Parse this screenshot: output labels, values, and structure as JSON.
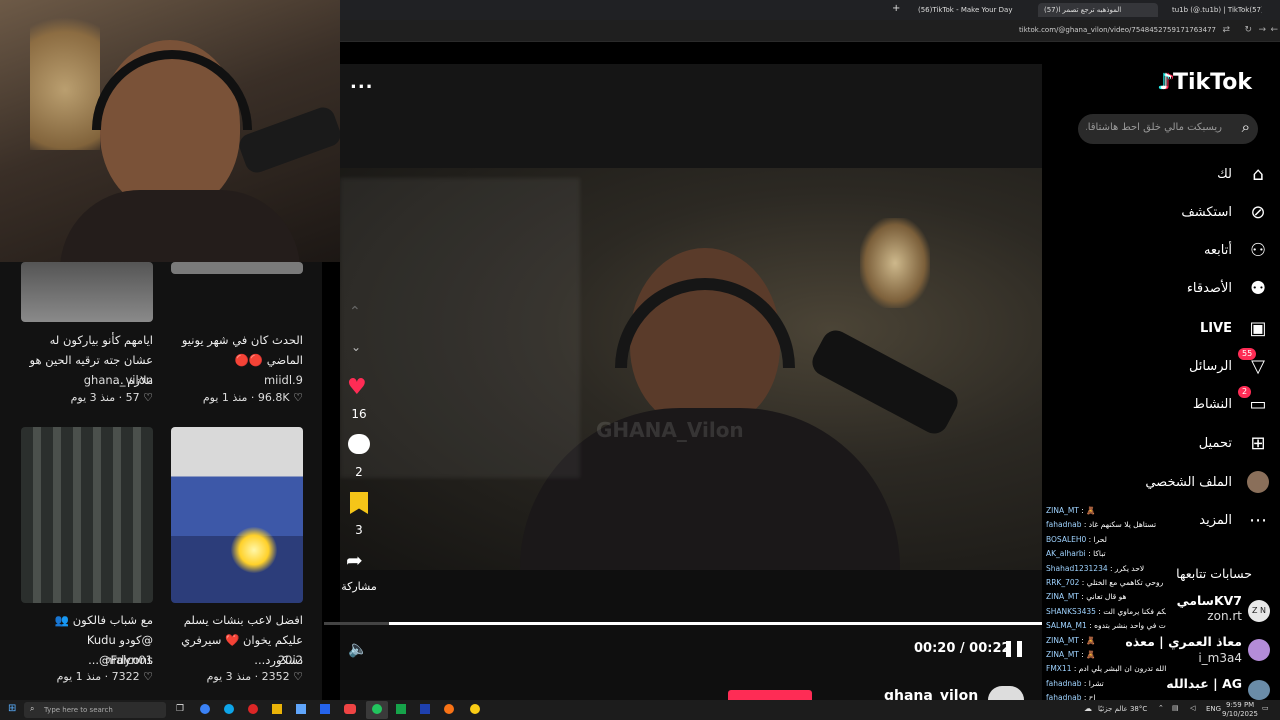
{
  "browser": {
    "tabs": [
      {
        "label": "(56)TikTok - Make Your Day"
      },
      {
        "label": "(57)الموذهبه ترجع تصمر ا"
      },
      {
        "label": "tu1b (@.tu1b) | TikTok(57)"
      }
    ],
    "url": "tiktok.com/@ghana_vilon/video/7548452759171763477"
  },
  "sidebar": {
    "logo": "TikTok",
    "search_placeholder": "ريسبكت مالي خلق احط هاشتاقا...",
    "nav": [
      {
        "label": "لك",
        "icon": "home-icon"
      },
      {
        "label": "استكشف",
        "icon": "compass-icon"
      },
      {
        "label": "أتابعه",
        "icon": "user-follow-icon"
      },
      {
        "label": "الأصدقاء",
        "icon": "friends-icon"
      },
      {
        "label": "LIVE",
        "icon": "live-tv-icon"
      },
      {
        "label": "الرسائل",
        "icon": "inbox-icon",
        "badge": "55"
      },
      {
        "label": "النشاط",
        "icon": "activity-icon",
        "badge": "2"
      },
      {
        "label": "تحميل",
        "icon": "upload-icon"
      },
      {
        "label": "الملف الشخصي",
        "icon": "profile-avatar-icon"
      },
      {
        "label": "المزيد",
        "icon": "more-dots-icon"
      }
    ],
    "following_title": "حسابات تتابعها",
    "following": [
      {
        "name": "KV7سامي",
        "handle": "zon.rt"
      },
      {
        "name": "معاذ العمري | معذه",
        "handle": "i_m3a4"
      },
      {
        "name": "AG | عبدالله",
        "handle": ""
      }
    ]
  },
  "chat": [
    {
      "user": "ZINA_MT",
      "msg": "🧸"
    },
    {
      "user": "fahadnab",
      "msg": "تستاهل يلا سكنهم غاد"
    },
    {
      "user": "BOSALEH0",
      "msg": "لحرا"
    },
    {
      "user": "AK_alharbi",
      "msg": "تباكا"
    },
    {
      "user": "Shahad1231234",
      "msg": "لاحد يكرر"
    },
    {
      "user": "RRK_702",
      "msg": "روحي تكاهمي مع الختلي"
    },
    {
      "user": "ZINA_MT",
      "msg": "هو قال تعاني"
    },
    {
      "user": "SHANKS3435",
      "msg": "علي رايكم فكنا يرماوي الت"
    },
    {
      "user": "SALMA_M1",
      "msg": "مودات في واحد بنشر بتدوه"
    },
    {
      "user": "ZINA_MT",
      "msg": "🧸"
    },
    {
      "user": "ZINA_MT",
      "msg": "🧸"
    },
    {
      "user": "FMX11",
      "msg": "سبحان الله تدرون ان البشر يلي ادم"
    },
    {
      "user": "fahadnab",
      "msg": "تشرا"
    },
    {
      "user": "fahadnab",
      "msg": "اح"
    }
  ],
  "player": {
    "menu": "...",
    "likes": "16",
    "comments": "2",
    "saves": "3",
    "share_label": "مشاركة",
    "time": "00:20 / 00:22",
    "progress": 0.91,
    "watermark": "GHANA_Vilon",
    "author": "ghana_vilon"
  },
  "grid": [
    {
      "title": "ايامهم كأنو بياركون له عشان جته ترقيه الحين هو ملازم ...",
      "author": "ghana_vilon",
      "likes": "57",
      "age": "منذ 3 يوم"
    },
    {
      "title": "الحدث كان في شهر يونيو الماضي 🔴🔴",
      "author": "miidl.9",
      "likes": "96.8K",
      "age": "منذ 1 يوم"
    },
    {
      "title": "مع شباب فالكون 👥 @كودو Kudu @Falcons...",
      "author": "nrdyn01",
      "likes": "7322",
      "age": "منذ 1 يوم"
    },
    {
      "title": "افضل لاعب بنشات يسلم عليكم يخوان ❤️ سيرفري دسكورد...",
      "author": "20i2",
      "likes": "2352",
      "age": "منذ 3 يوم"
    }
  ],
  "taskbar": {
    "search_placeholder": "Type here to search",
    "weather": "38°C  عالم جزئيًا",
    "lang": "ENG",
    "time": "9:59 PM",
    "date": "9/10/2025"
  }
}
